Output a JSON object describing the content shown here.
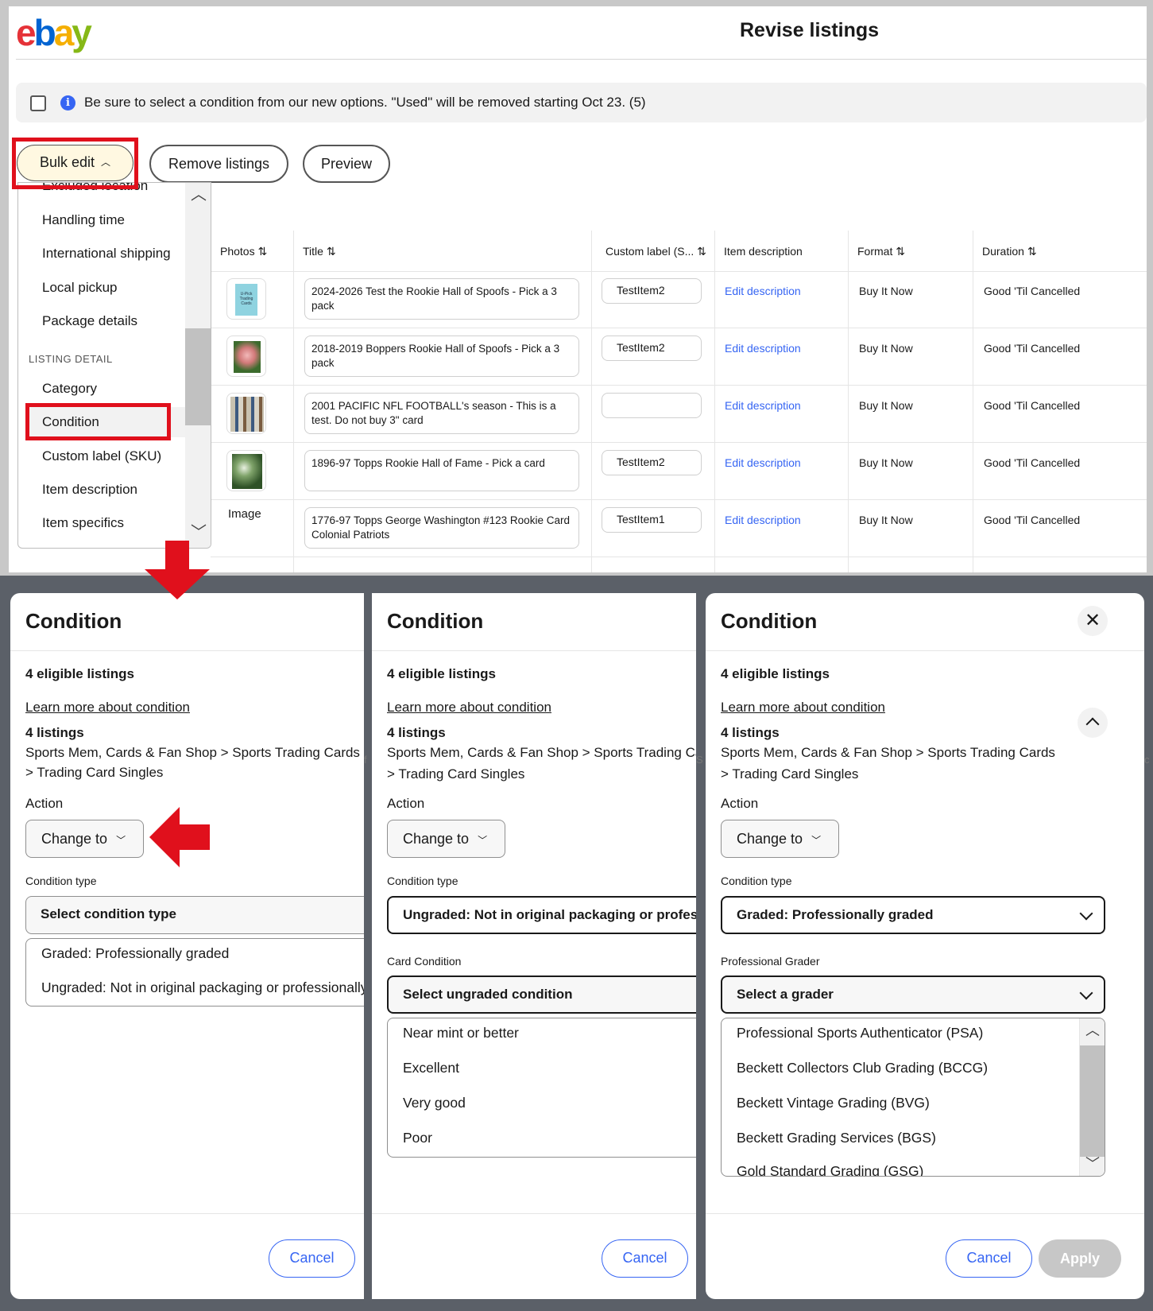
{
  "header": {
    "logo": "ebay",
    "title": "Revise listings"
  },
  "notice": {
    "text": "Be sure to select a condition from our new options. \"Used\" will be removed starting Oct 23. (5)"
  },
  "toolbar": {
    "bulk_edit": "Bulk edit",
    "remove": "Remove listings",
    "preview": "Preview"
  },
  "menu": {
    "partial_item": "Excluded location",
    "items_a": [
      "Handling time",
      "International shipping",
      "Local pickup",
      "Package details"
    ],
    "section": "LISTING DETAIL",
    "items_b": [
      "Category",
      "Condition",
      "Custom label (SKU)",
      "Item description",
      "Item specifics"
    ]
  },
  "table": {
    "columns": [
      "Photos",
      "Title",
      "Custom label (S...",
      "Item description",
      "Format",
      "Duration"
    ],
    "rows": [
      {
        "photo": "U-Pick Trading Cards",
        "title": "2024-2026 Test the Rookie Hall of Spoofs - Pick a 3 pack",
        "sku": "TestItem2",
        "desc": "Edit description",
        "format": "Buy It Now",
        "duration": "Good 'Til Cancelled"
      },
      {
        "photo": "",
        "title": "2018-2019 Boppers Rookie Hall of Spoofs - Pick a 3 pack",
        "sku": "TestItem2",
        "desc": "Edit description",
        "format": "Buy It Now",
        "duration": "Good 'Til Cancelled"
      },
      {
        "photo": "",
        "title": "2001 PACIFIC NFL FOOTBALL's season - This is a test. Do not buy 3\" card",
        "sku": "",
        "desc": "Edit description",
        "format": "Buy It Now",
        "duration": "Good 'Til Cancelled"
      },
      {
        "photo": "",
        "title": "1896-97 Topps Rookie Hall of Fame - Pick a card",
        "sku": "TestItem2",
        "desc": "Edit description",
        "format": "Buy It Now",
        "duration": "Good 'Til Cancelled"
      },
      {
        "photo": "Image",
        "title": "1776-97 Topps George Washington #123 Rookie Card Colonial Patriots",
        "sku": "TestItem1",
        "desc": "Edit description",
        "format": "Buy It Now",
        "duration": "Good 'Til Cancelled"
      }
    ]
  },
  "panel_common": {
    "title": "Condition",
    "eligible": "4 eligible listings",
    "learn_more": "Learn more about condition",
    "listings": "4 listings",
    "category_line1": "Sports Mem, Cards & Fan Shop > Sports Trading Cards",
    "category_line2": "> Trading Card Singles",
    "action_label": "Action",
    "action_value": "Change to",
    "condition_type_label": "Condition type",
    "cancel": "Cancel",
    "apply": "Apply"
  },
  "panel1": {
    "select_placeholder": "Select condition type",
    "options": [
      "Graded: Professionally graded",
      "Ungraded: Not in original packaging or professionally graded"
    ]
  },
  "panel2": {
    "selected": "Ungraded: Not in original packaging or professionally graded",
    "card_condition_label": "Card Condition",
    "card_placeholder": "Select ungraded condition",
    "options": [
      "Near mint or better",
      "Excellent",
      "Very good",
      "Poor"
    ]
  },
  "panel3": {
    "selected": "Graded: Professionally graded",
    "grader_label": "Professional Grader",
    "grader_placeholder": "Select a grader",
    "options": [
      "Professional Sports Authenticator (PSA)",
      "Beckett Collectors Club Grading (BCCG)",
      "Beckett Vintage Grading (BVG)",
      "Beckett Grading Services (BGS)",
      "Gold Standard Grading (GSG)"
    ]
  },
  "colors": {
    "annotation_red": "#e0101c",
    "link_blue": "#3665f3"
  }
}
